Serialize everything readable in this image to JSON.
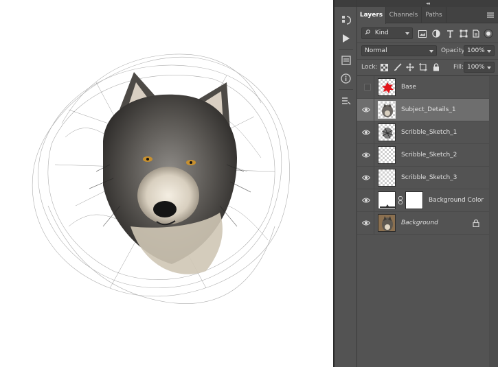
{
  "panel": {
    "collapse_glyph": "◂◂",
    "tabs": [
      {
        "label": "Layers",
        "active": true
      },
      {
        "label": "Channels",
        "active": false
      },
      {
        "label": "Paths",
        "active": false
      }
    ]
  },
  "filter": {
    "kind_label": "Kind",
    "icons": [
      "pixel-filter-icon",
      "adjustment-filter-icon",
      "type-filter-icon",
      "shape-filter-icon",
      "smart-object-filter-icon"
    ]
  },
  "blend": {
    "mode": "Normal",
    "opacity_label": "Opacity:",
    "opacity_value": "100%"
  },
  "lock": {
    "label": "Lock:",
    "fill_label": "Fill:",
    "fill_value": "100%"
  },
  "layers": [
    {
      "name": "Base",
      "visible": false,
      "thumb": "red-splat",
      "selected": false
    },
    {
      "name": "Subject_Details_1",
      "visible": true,
      "thumb": "wolf-sketch",
      "selected": true
    },
    {
      "name": "Scribble_Sketch_1",
      "visible": true,
      "thumb": "scribble-dark",
      "selected": false
    },
    {
      "name": "Scribble_Sketch_2",
      "visible": true,
      "thumb": "transparent",
      "selected": false
    },
    {
      "name": "Scribble_Sketch_3",
      "visible": true,
      "thumb": "transparent",
      "selected": false
    },
    {
      "name": "Background Color",
      "visible": true,
      "thumb": "solid-fill",
      "selected": false
    },
    {
      "name": "Background",
      "visible": true,
      "thumb": "wolf-photo",
      "selected": false,
      "locked": true
    }
  ],
  "colors": {
    "panel_bg": "#535353",
    "selected_row": "#6e6e6e",
    "canvas_bg": "#ffffff"
  }
}
